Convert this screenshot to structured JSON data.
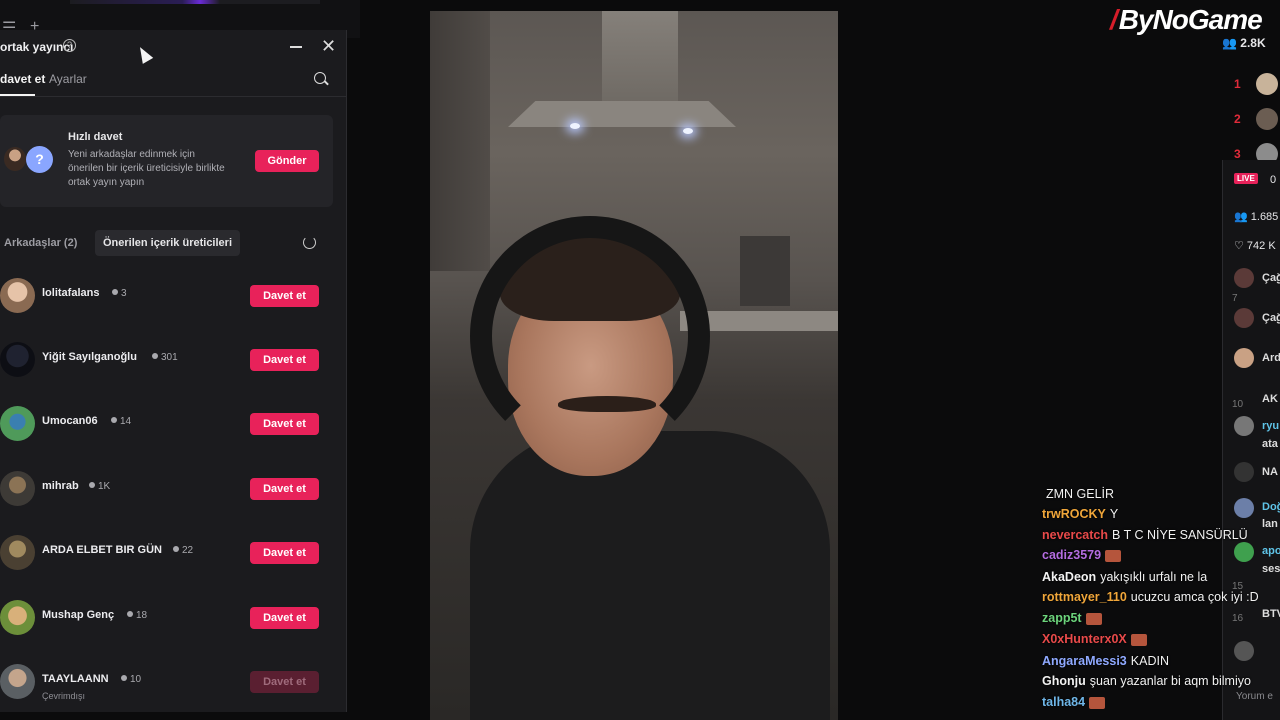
{
  "panel": {
    "title": "ortak yayıncı",
    "tabs": {
      "invite": "davet et",
      "settings": "Ayarlar"
    },
    "quick_invite": {
      "title": "Hızlı davet",
      "description": "Yeni arkadaşlar edinmek için önerilen bir içerik üreticisiyle birlikte ortak yayın yapın",
      "button": "Gönder"
    },
    "friends_label": "Arkadaşlar (2)",
    "suggested_label": "Önerilen içerik üreticileri",
    "creators": [
      {
        "name": "lolitafalans",
        "followers": "3",
        "button": "Davet et",
        "sub": ""
      },
      {
        "name": "Yiğit Sayılganoğlu",
        "followers": "301",
        "button": "Davet et",
        "sub": ""
      },
      {
        "name": "Umocan06",
        "followers": "14",
        "button": "Davet et",
        "sub": ""
      },
      {
        "name": "mihrab",
        "followers": "1K",
        "button": "Davet et",
        "sub": ""
      },
      {
        "name": "ARDA ELBET BIR GÜN",
        "followers": "22",
        "button": "Davet et",
        "sub": ""
      },
      {
        "name": "Mushap Genç",
        "followers": "18",
        "button": "Davet et",
        "sub": ""
      },
      {
        "name": "TAAYLAANN",
        "followers": "10",
        "button": "Davet et",
        "sub": "Çevrimdışı"
      }
    ]
  },
  "brand": {
    "name": "ByNoGame",
    "viewers": "2.8K"
  },
  "ranking": [
    "1",
    "2",
    "3"
  ],
  "side": {
    "live": "LIVE",
    "stat1": "0",
    "viewers": "1.685",
    "likes": "742 K",
    "items": [
      {
        "num": "",
        "name": "Çağ"
      },
      {
        "num": "7",
        "name": "Çağ"
      },
      {
        "num": "",
        "name": "Ard"
      },
      {
        "num": "10",
        "name": "AK"
      },
      {
        "num": "",
        "name": "ryu"
      },
      {
        "num": "",
        "name": "ata"
      },
      {
        "num": "",
        "name": "NA"
      },
      {
        "num": "",
        "name": "Doğ"
      },
      {
        "num": "",
        "name": "lan"
      },
      {
        "num": "",
        "name": "apo"
      },
      {
        "num": "",
        "name": "ses"
      },
      {
        "num": "15",
        "name": ""
      },
      {
        "num": "",
        "name": "BTV"
      },
      {
        "num": "16",
        "name": ""
      }
    ],
    "comment_placeholder": "Yorum e"
  },
  "chat": [
    {
      "user": "",
      "text": "ZMN GELİR",
      "color": "#ffffff"
    },
    {
      "user": "trwROCKY",
      "text": "Y",
      "color": "#f0a63a"
    },
    {
      "user": "nevercatch",
      "text": "B T C NİYE SANSÜRLÜ",
      "color": "#e84a4a"
    },
    {
      "user": "cadiz3579",
      "text": "",
      "color": "#b46ce0",
      "emote": true
    },
    {
      "user": "AkaDeon",
      "text": "yakışıklı urfalı ne la",
      "color": "#f2f2f2"
    },
    {
      "user": "rottmayer_110",
      "text": "ucuzcu amca çok iyi :D",
      "color": "#f0a63a"
    },
    {
      "user": "zapp5t",
      "text": "",
      "color": "#6cd47c",
      "emote": true
    },
    {
      "user": "X0xHunterx0X",
      "text": "",
      "color": "#e84a4a",
      "emote": true
    },
    {
      "user": "AngaraMessi3",
      "text": "KADIN",
      "color": "#8fa9ff"
    },
    {
      "user": "Ghonju",
      "text": "şuan yazanlar bi aqm bilmiyo",
      "color": "#f2f2f2"
    },
    {
      "user": "talha84",
      "text": "",
      "color": "#6fb6e8",
      "emote": true
    }
  ]
}
